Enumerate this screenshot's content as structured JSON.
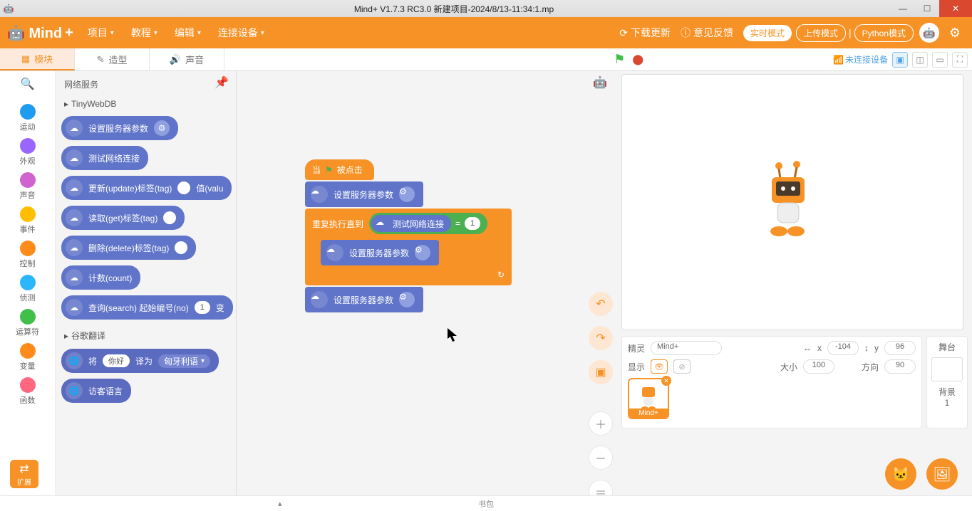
{
  "title": "Mind+ V1.7.3 RC3.0   新建项目-2024/8/13-11:34:1.mp",
  "menu": {
    "items": [
      "项目",
      "教程",
      "编辑",
      "连接设备"
    ],
    "download": "下载更新",
    "feedback": "意见反馈",
    "mode_rt": "实时模式",
    "mode_upload": "上传模式",
    "mode_python": "Python模式"
  },
  "tabs": {
    "blocks": "模块",
    "costumes": "造型",
    "sounds": "声音"
  },
  "topright": {
    "device": "未连接设备"
  },
  "categories": [
    {
      "label": "运动",
      "color": "#1f9cf0"
    },
    {
      "label": "外观",
      "color": "#9966ff"
    },
    {
      "label": "声音",
      "color": "#cf63cf"
    },
    {
      "label": "事件",
      "color": "#ffbf00"
    },
    {
      "label": "控制",
      "color": "#ff8c1a"
    },
    {
      "label": "侦测",
      "color": "#2bb6ff"
    },
    {
      "label": "运算符",
      "color": "#40bf4a"
    },
    {
      "label": "变量",
      "color": "#ff8c1a"
    },
    {
      "label": "函数",
      "color": "#ff6680"
    }
  ],
  "palette": {
    "header": "网络服务",
    "section1": "TinyWebDB",
    "b1": "设置服务器参数",
    "b2": "测试网络连接",
    "b3": "更新(update)标签(tag)",
    "b3b": "值(valu",
    "b4": "读取(get)标签(tag)",
    "b5": "删除(delete)标签(tag)",
    "b6": "计数(count)",
    "b7": "查询(search) 起始编号(no)",
    "b7n": "1",
    "b7s": "变",
    "section2": "谷歌翻译",
    "t1a": "将",
    "t1b": "你好",
    "t1c": "译为",
    "t1d": "匈牙利语",
    "t2": "访客语言"
  },
  "script": {
    "hat": "当",
    "hat2": "被点击",
    "s1": "设置服务器参数",
    "loop": "重复执行直到",
    "cond": "测试网络连接",
    "eq": "=",
    "one": "1",
    "s2": "设置服务器参数",
    "s3": "设置服务器参数"
  },
  "sprite": {
    "label_sprite": "精灵",
    "name": "Mind+",
    "x_lbl": "x",
    "x": "-104",
    "y_lbl": "y",
    "y": "96",
    "show_lbl": "显示",
    "size_lbl": "大小",
    "size": "100",
    "dir_lbl": "方向",
    "dir": "90",
    "thumb": "Mind+"
  },
  "stage": {
    "label": "舞台",
    "bg_lbl": "背景",
    "bg_n": "1"
  },
  "ext": "扩展",
  "bottom": "书包"
}
